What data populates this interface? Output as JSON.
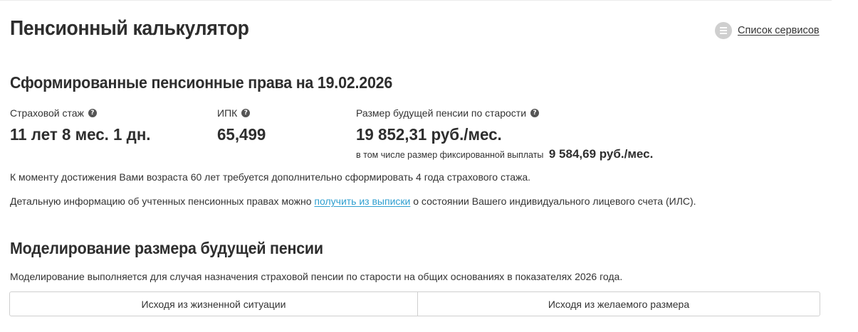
{
  "header": {
    "title": "Пенсионный калькулятор",
    "services_link": "Список сервисов",
    "services_icon": "menu-icon"
  },
  "rights": {
    "title": "Сформированные пенсионные права на 19.02.2026",
    "stazh": {
      "label": "Страховой стаж",
      "value": "11 лет 8 мес. 1 дн."
    },
    "ipk": {
      "label": "ИПК",
      "value": "65,499"
    },
    "pension": {
      "label": "Размер будущей пенсии по старости",
      "value": "19 852,31 руб./мес.",
      "fixed_label": "в том числе размер фиксированной выплаты",
      "fixed_value": "9 584,69 руб./мес."
    },
    "help_icon": "?",
    "note_age": "К моменту достижения Вами возраста 60 лет требуется дополнительно сформировать 4 года страхового стажа.",
    "details_prefix": "Детальную информацию об учтенных пенсионных правах можно",
    "details_link": "получить из выписки",
    "details_suffix": "о состоянии Вашего индивидуального лицевого счета (ИЛС)."
  },
  "modeling": {
    "title": "Моделирование размера будущей пенсии",
    "description": "Моделирование выполняется для случая назначения страховой пенсии по старости на общих основаниях в показателях 2026 года.",
    "tabs": [
      {
        "label": "Исходя из жизненной ситуации"
      },
      {
        "label": "Исходя из желаемого размера"
      }
    ]
  },
  "colors": {
    "link": "#2f9fd0",
    "text": "#2e2e2e",
    "border": "#cfcfcf",
    "icon_bg": "#cfcfcf"
  }
}
